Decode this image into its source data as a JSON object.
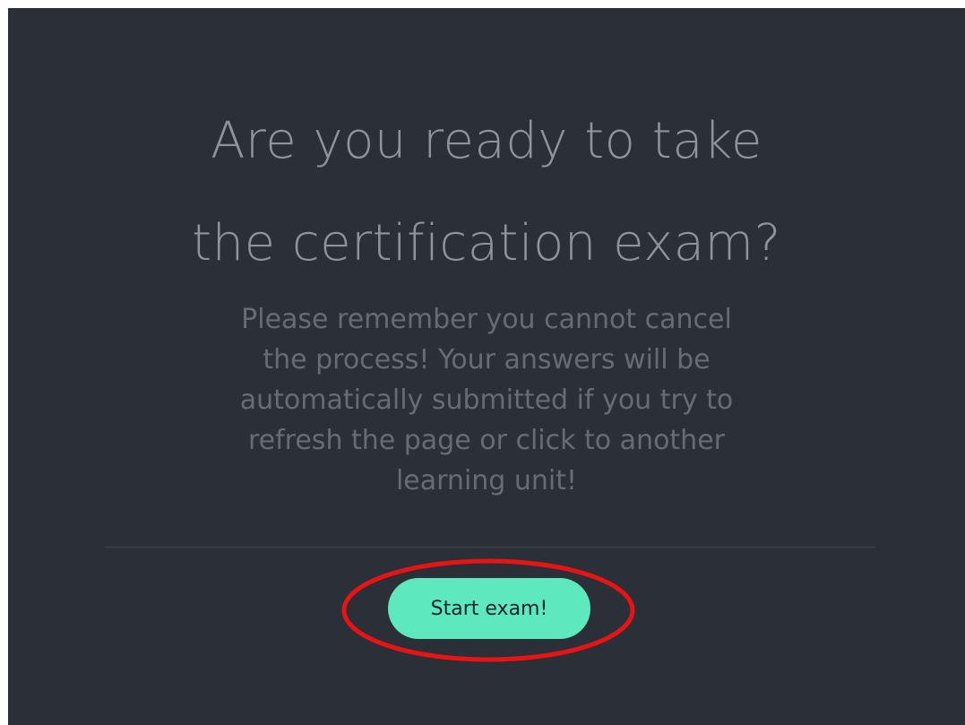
{
  "dialog": {
    "title_line1": "Are you ready to take",
    "title_line2": "the certification exam?",
    "message_lines": [
      "Please remember you cannot cancel",
      "the process! Your answers will be",
      "automatically submitted if you try to",
      "refresh the page or click to another",
      "learning unit!"
    ],
    "start_button_label": "Start exam!"
  },
  "colors": {
    "panel_background": "#2b2f38",
    "title_text": "#8f949b",
    "message_text": "#676c74",
    "button_background": "#5ee8bd",
    "button_text": "#1c2330",
    "annotation_ring": "#e81414"
  }
}
